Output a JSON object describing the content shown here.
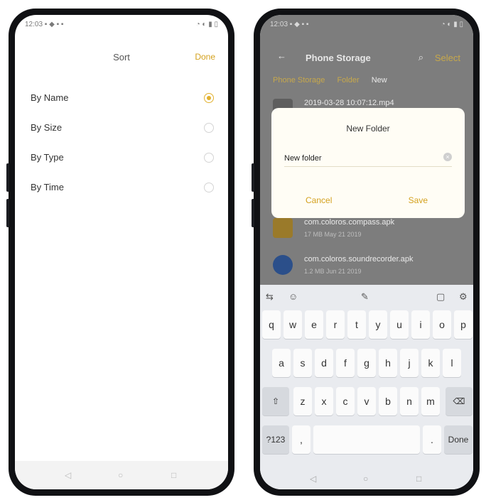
{
  "left": {
    "status": {
      "left": "12:03 ▪ ◆ ▪ ▪",
      "right": "◔ ◐ ▮ ▯"
    },
    "header": {
      "title": "Sort",
      "done": "Done"
    },
    "options": [
      {
        "label": "By Name",
        "selected": true
      },
      {
        "label": "By Size",
        "selected": false
      },
      {
        "label": "By Type",
        "selected": false
      },
      {
        "label": "By Time",
        "selected": false
      }
    ],
    "nav": {
      "back": "◁",
      "home": "○",
      "recent": "□"
    }
  },
  "right": {
    "status": {
      "left": "12:03 ▪ ◆ ▪ ▪",
      "right": "◔ ◐ ▮ ▯"
    },
    "header": {
      "back": "←",
      "title": "Phone Storage",
      "search": "⌕",
      "select": "Select"
    },
    "breadcrumbs": [
      "Phone Storage",
      "Folder",
      "New"
    ],
    "files": [
      {
        "name": "2019-03-28 10:07:12.mp4",
        "meta": ""
      },
      {
        "name": "com.coloros.compass.apk",
        "meta": "17 MB  May 21 2019"
      },
      {
        "name": "com.coloros.soundrecorder.apk",
        "meta": "1.2 MB  Jun 21 2019"
      }
    ],
    "dialog": {
      "title": "New Folder",
      "value": "New folder",
      "clear": "×",
      "cancel": "Cancel",
      "save": "Save"
    },
    "keyboard": {
      "toolbar": {
        "cursor": "⇆",
        "emoji": "☺",
        "mic": "✎",
        "clipboard": "▢",
        "settings": "⚙"
      },
      "row1": [
        "q",
        "w",
        "e",
        "r",
        "t",
        "y",
        "u",
        "i",
        "o",
        "p"
      ],
      "row2": [
        "a",
        "s",
        "d",
        "f",
        "g",
        "h",
        "j",
        "k",
        "l"
      ],
      "row3": [
        "z",
        "x",
        "c",
        "v",
        "b",
        "n",
        "m"
      ],
      "shift": "⇧",
      "backspace": "⌫",
      "num": "?123",
      "comma": ",",
      "period": ".",
      "done": "Done"
    },
    "nav": {
      "back": "◁",
      "home": "○",
      "recent": "□"
    }
  },
  "colors": {
    "accent": "#d4a11e",
    "radio": "#e2b12e",
    "dim": "#7d7d7d"
  }
}
